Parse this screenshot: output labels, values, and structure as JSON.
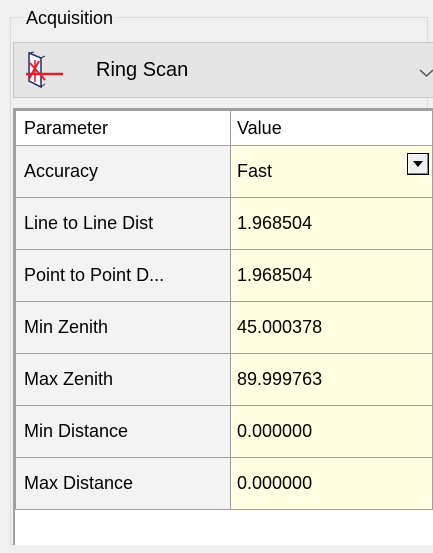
{
  "group": {
    "label": "Acquisition"
  },
  "scan_type": {
    "selected": "Ring Scan",
    "icon": "ring-scan-icon"
  },
  "properties": {
    "columns": [
      "Parameter",
      "Value"
    ],
    "rows": [
      {
        "name": "Accuracy",
        "value": "Fast"
      },
      {
        "name": "Line to Line Dist",
        "value": "1.968504"
      },
      {
        "name": "Point to Point D...",
        "value": "1.968504"
      },
      {
        "name": "Min Zenith",
        "value": "45.000378"
      },
      {
        "name": "Max Zenith",
        "value": "89.999763"
      },
      {
        "name": "Min Distance",
        "value": "0.000000"
      },
      {
        "name": "Max Distance",
        "value": "0.000000"
      }
    ]
  },
  "colors": {
    "value_cell_bg": "#ffffe1",
    "name_cell_bg": "#f3f3f3",
    "grid_line": "#a0a0a0",
    "icon_red": "#e0202a"
  }
}
